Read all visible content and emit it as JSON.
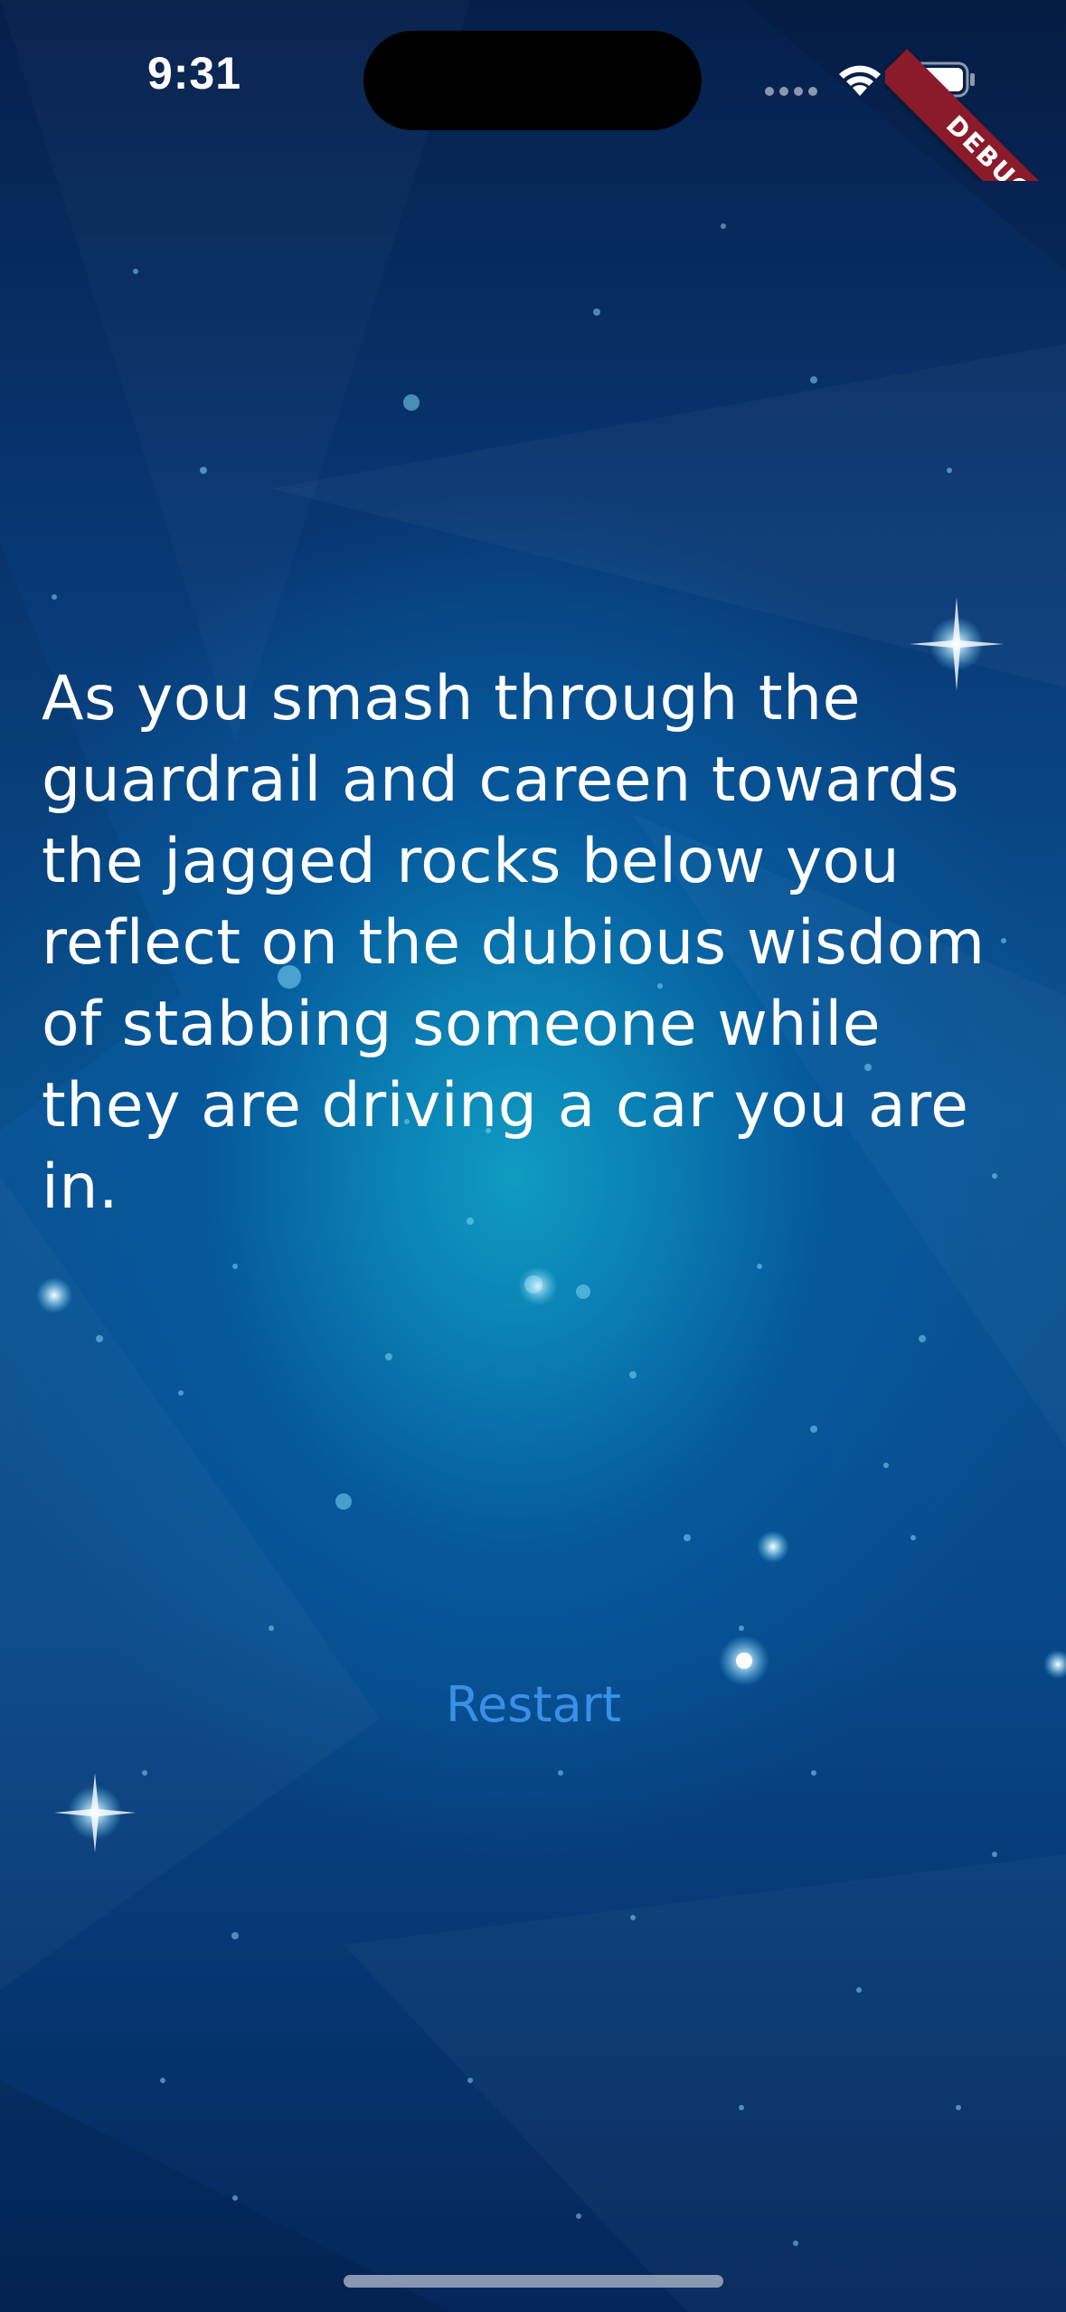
{
  "status_bar": {
    "time": "9:31",
    "signal_icon": "cellular-dots-icon",
    "wifi_icon": "wifi-icon",
    "battery_icon": "battery-icon"
  },
  "debug_banner": {
    "label": "DEBUG",
    "color": "#8b1b2a"
  },
  "story": {
    "text": "As you smash through the guardrail and careen towards the jagged rocks below you reflect on the dubious wisdom of stabbing someone while they are driving a car you are in."
  },
  "actions": {
    "restart_label": "Restart"
  },
  "colors": {
    "accent": "#3a8fe6",
    "text": "#ffffff"
  }
}
